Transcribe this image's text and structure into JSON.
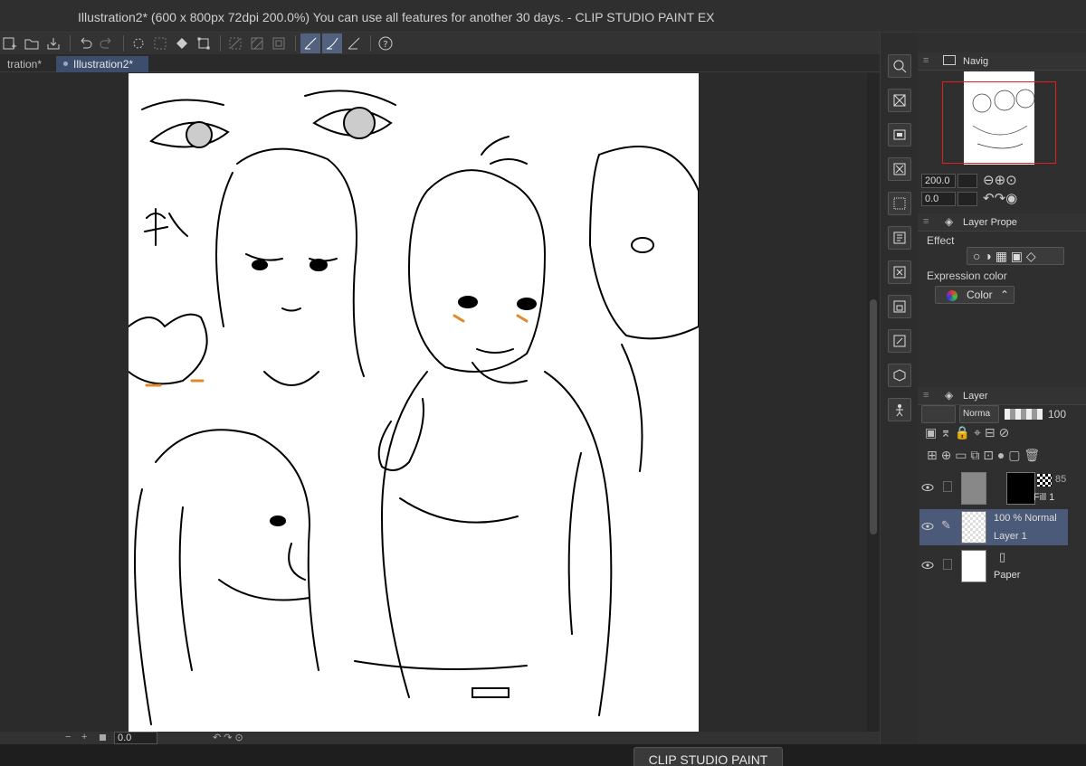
{
  "window": {
    "title": "Illustration2* (600 x 800px 72dpi 200.0%)  You can use all features for another 30 days. - CLIP STUDIO PAINT EX"
  },
  "tabs": [
    {
      "label": "tration*"
    },
    {
      "label": "Illustration2*"
    }
  ],
  "statusbar": {
    "zoom_value": "0.0"
  },
  "tooltip": "CLIP STUDIO PAINT",
  "navigator": {
    "title": "Navig",
    "zoom": "200.0",
    "rotation": "0.0"
  },
  "layer_property": {
    "title": "Layer Prope",
    "effect_label": "Effect",
    "expression_color_label": "Expression color",
    "expression_color_value": "Color"
  },
  "layer_panel": {
    "title": "Layer",
    "blend_mode": "Norma",
    "opacity": "100",
    "layers": [
      {
        "name": "Fill 1",
        "extra": "85",
        "status": ""
      },
      {
        "name": "Layer 1",
        "status": "100 %  Normal"
      },
      {
        "name": "Paper",
        "status": ""
      }
    ]
  },
  "colors": {
    "selection_blue": "#52627e",
    "layer_selected": "#4b5a78",
    "nav_frame": "#e02020"
  }
}
